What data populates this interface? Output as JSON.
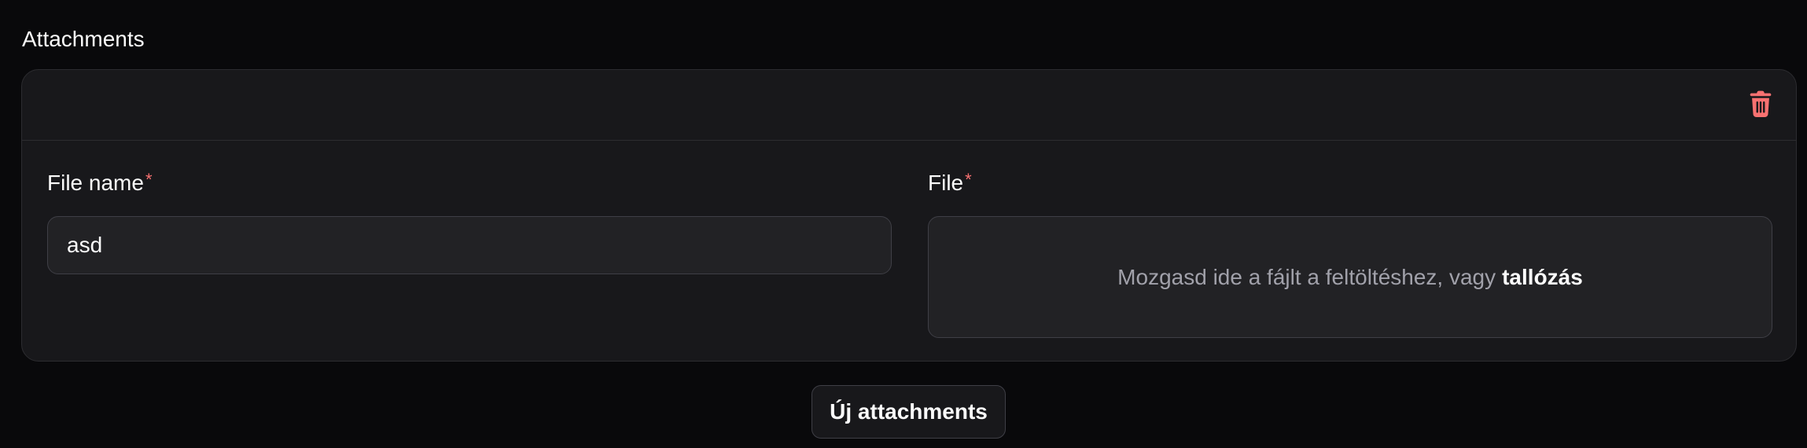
{
  "section": {
    "title": "Attachments"
  },
  "item": {
    "delete_icon": "trash-icon",
    "file_name_field": {
      "label": "File name",
      "required_marker": "*",
      "value": "asd"
    },
    "file_field": {
      "label": "File",
      "required_marker": "*",
      "dropzone_text": "Mozgasd ide a fájlt a feltöltéshez, vagy",
      "browse_link": "tallózás"
    }
  },
  "add_button": {
    "label": "Új attachments"
  },
  "colors": {
    "background": "#09090b",
    "card": "#18181b",
    "input": "#222225",
    "border": "#3f3f46",
    "danger": "#f87171",
    "text": "#fafafa",
    "muted": "#a1a1aa"
  }
}
